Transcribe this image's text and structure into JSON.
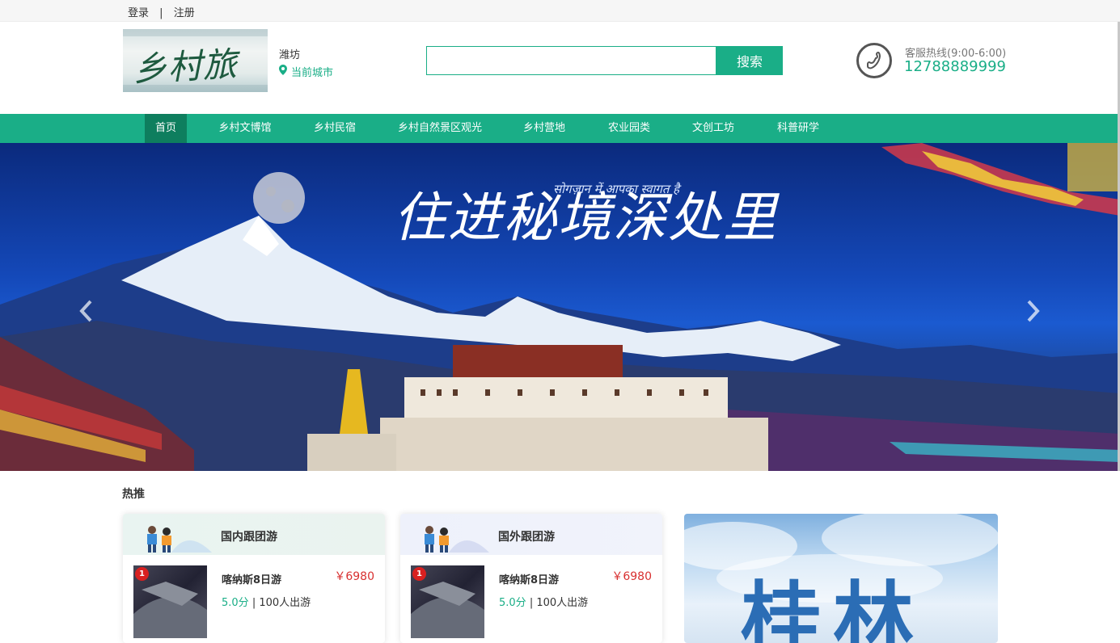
{
  "topbar": {
    "login": "登录",
    "separator": "|",
    "register": "注册"
  },
  "header": {
    "logo_text": "乡村旅游",
    "city": "潍坊",
    "current_city_label": "当前城市",
    "search": {
      "value": "",
      "placeholder": "",
      "button_label": "搜索"
    },
    "hotline_label": "客服热线(9:00-6:00)",
    "hotline_number": "12788889999"
  },
  "nav": {
    "items": [
      {
        "label": "首页",
        "active": true
      },
      {
        "label": "乡村文博馆",
        "active": false
      },
      {
        "label": "乡村民宿",
        "active": false
      },
      {
        "label": "乡村自然景区观光",
        "active": false
      },
      {
        "label": "乡村营地",
        "active": false
      },
      {
        "label": "农业园类",
        "active": false
      },
      {
        "label": "文创工坊",
        "active": false
      },
      {
        "label": "科普研学",
        "active": false
      }
    ]
  },
  "banner": {
    "headline": "住进秘境深处里",
    "subline": "सोगज़ान में आपका स्वागत है",
    "prev_icon": "chevron-left-icon",
    "next_icon": "chevron-right-icon"
  },
  "hot": {
    "title": "热推",
    "cards": [
      {
        "title": "国内跟团游",
        "item": {
          "rank": "1",
          "name": "喀纳斯8日游",
          "price": "￥6980",
          "score": "5.0分",
          "separator": "|",
          "travelers": "100人出游"
        }
      },
      {
        "title": "国外跟团游",
        "item": {
          "rank": "1",
          "name": "喀纳斯8日游",
          "price": "￥6980",
          "score": "5.0分",
          "separator": "|",
          "travelers": "100人出游"
        }
      }
    ],
    "promo_text": "桂林"
  },
  "colors": {
    "accent": "#1aae87",
    "nav_active": "#0e7e5e",
    "price": "#d83030"
  }
}
